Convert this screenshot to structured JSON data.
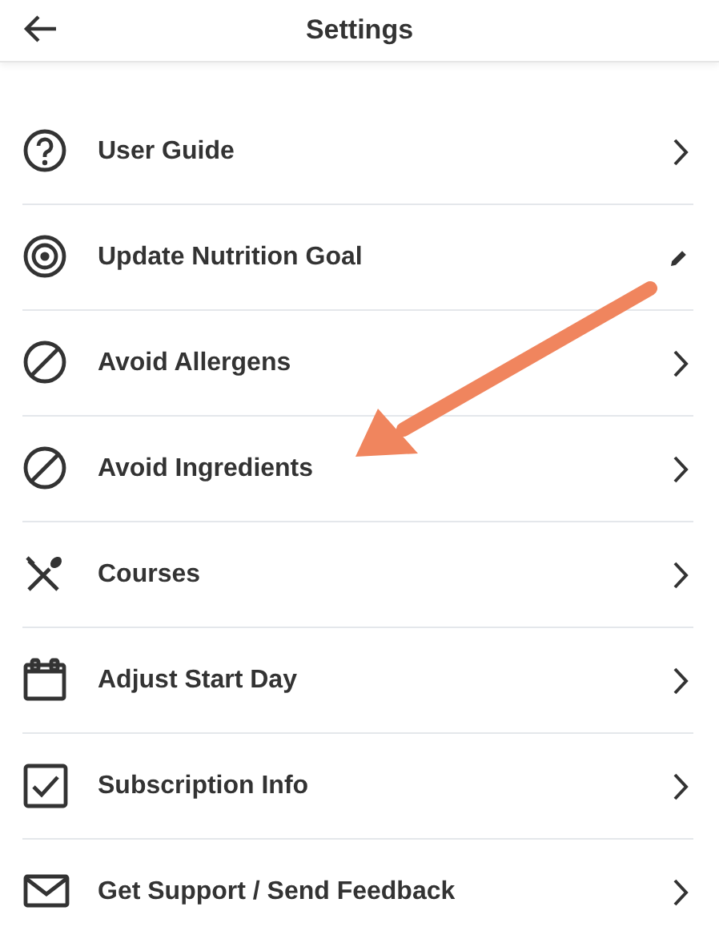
{
  "header": {
    "title": "Settings"
  },
  "items": [
    {
      "label": "User Guide",
      "kind": "help",
      "editable": false
    },
    {
      "label": "Update Nutrition Goal",
      "kind": "target",
      "editable": true
    },
    {
      "label": "Avoid Allergens",
      "kind": "blocked",
      "editable": false
    },
    {
      "label": "Avoid Ingredients",
      "kind": "blocked",
      "editable": false
    },
    {
      "label": "Courses",
      "kind": "utensils",
      "editable": false
    },
    {
      "label": "Adjust Start Day",
      "kind": "calendar",
      "editable": false
    },
    {
      "label": "Subscription Info",
      "kind": "checkbox",
      "editable": false
    },
    {
      "label": "Get Support / Send Feedback",
      "kind": "mail",
      "editable": false
    }
  ],
  "annotation": {
    "kind": "arrow"
  }
}
